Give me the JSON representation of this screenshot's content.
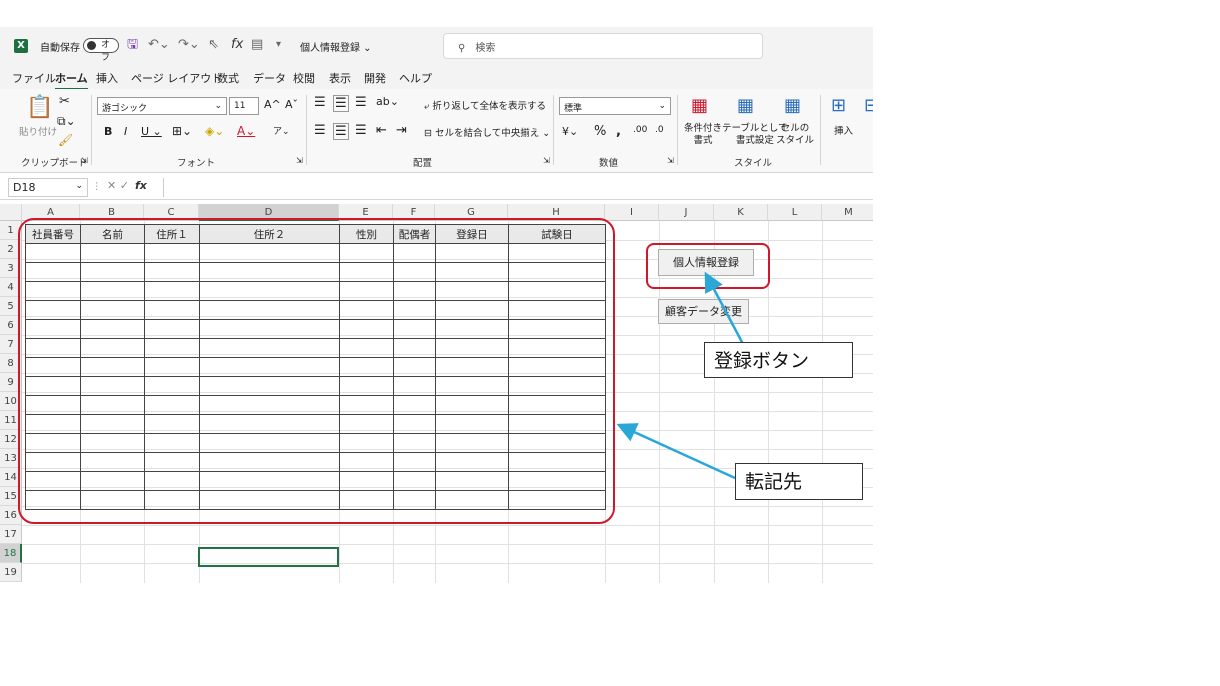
{
  "titlebar": {
    "autosave_label": "自動保存",
    "autosave_state": "オフ",
    "doc_title": "個人情報登録",
    "search_placeholder": "検索"
  },
  "menu": [
    "ファイル",
    "ホーム",
    "挿入",
    "ページ レイアウト",
    "数式",
    "データ",
    "校閲",
    "表示",
    "開発",
    "ヘルプ"
  ],
  "ribbon": {
    "clipboard": {
      "paste": "貼り付け",
      "label": "クリップボード"
    },
    "font": {
      "name": "游ゴシック",
      "size": "11",
      "label": "フォント"
    },
    "alignment": {
      "wrap": "折り返して全体を表示する",
      "merge": "セルを結合して中央揃え",
      "label": "配置"
    },
    "number": {
      "format": "標準",
      "label": "数値"
    },
    "styles": {
      "conditional": "条件付き\n書式",
      "table": "テーブルとして\n書式設定",
      "cell": "セルの\nスタイル",
      "label": "スタイル"
    },
    "cells": {
      "insert": "挿入"
    }
  },
  "formula_bar": {
    "name_box": "D18",
    "formula": ""
  },
  "columns": [
    "A",
    "B",
    "C",
    "D",
    "E",
    "F",
    "G",
    "H",
    "I",
    "J",
    "K",
    "L",
    "M"
  ],
  "rows": [
    "1",
    "2",
    "3",
    "4",
    "5",
    "6",
    "7",
    "8",
    "9",
    "10",
    "11",
    "12",
    "13",
    "14",
    "15",
    "16",
    "17",
    "18",
    "19"
  ],
  "table": {
    "headers": [
      "社員番号",
      "名前",
      "住所１",
      "住所２",
      "性別",
      "配偶者",
      "登録日",
      "試験日"
    ],
    "empty_rows": 14
  },
  "buttons": {
    "register": "個人情報登録",
    "change": "顧客データ変更"
  },
  "annotations": {
    "register_callout": "登録ボタン",
    "dest_callout": "転記先"
  },
  "colors": {
    "excel_green": "#217346",
    "annotation_red": "#d0182c",
    "arrow_blue": "#29a8d8"
  }
}
